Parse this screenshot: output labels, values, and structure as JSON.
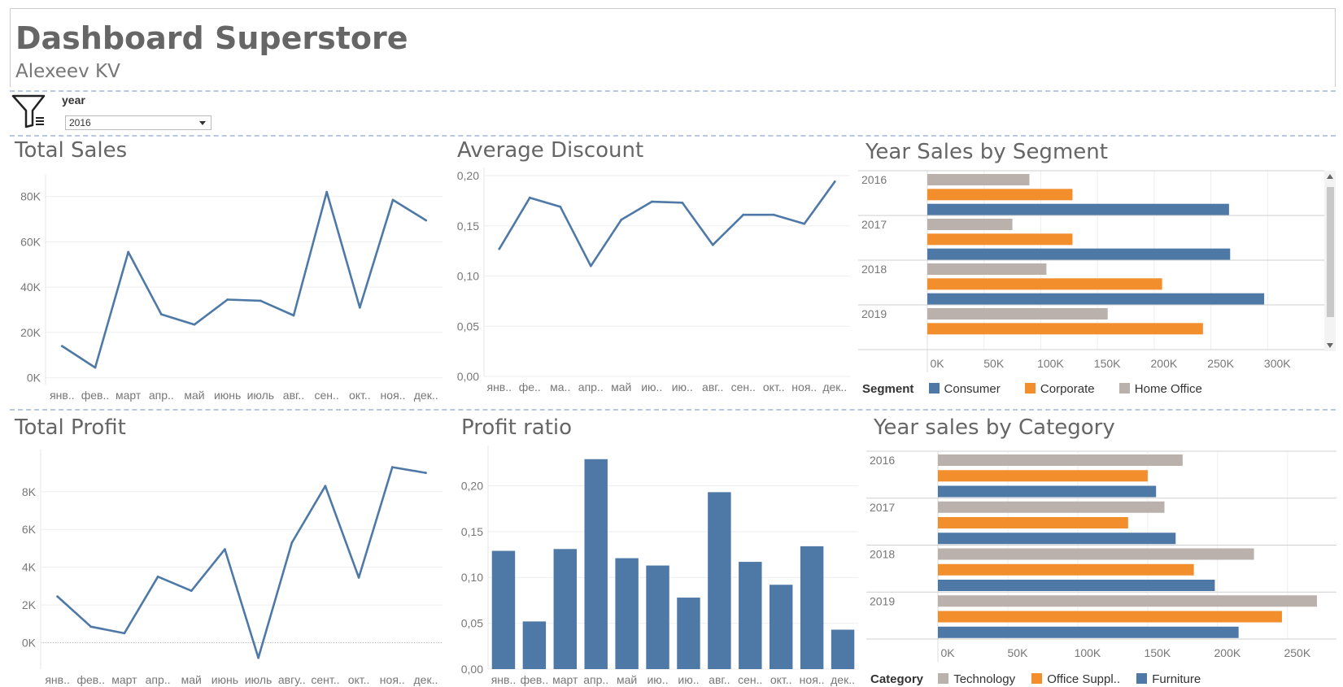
{
  "header": {
    "title": "Dashboard Superstore",
    "subtitle": "Alexeev KV"
  },
  "filter": {
    "label": "year",
    "value": "2016",
    "icon": "filter-icon"
  },
  "colors": {
    "consumer": "#4e79a7",
    "corporate": "#f28e2b",
    "home_office": "#bab0ac",
    "line": "#4e79a7"
  },
  "chart_data": [
    {
      "id": "total_sales",
      "type": "line",
      "title": "Total Sales",
      "categories": [
        "янв..",
        "фев..",
        "март",
        "апр..",
        "май",
        "июнь",
        "июль",
        "авг..",
        "сен..",
        "окт..",
        "ноя..",
        "дек.."
      ],
      "values": [
        14000,
        4500,
        55500,
        28000,
        23500,
        34500,
        34000,
        27500,
        82000,
        31000,
        78500,
        69500
      ],
      "yticks": [
        0,
        20000,
        40000,
        60000,
        80000
      ],
      "ytick_labels": [
        "0K",
        "20K",
        "40K",
        "60K",
        "80K"
      ],
      "ylim": [
        -3000,
        86000
      ]
    },
    {
      "id": "avg_discount",
      "type": "line",
      "title": "Average Discount",
      "categories": [
        "янв..",
        "фе..",
        "ма..",
        "апр..",
        "май",
        "ию..",
        "ию..",
        "авг..",
        "сен..",
        "окт..",
        "ноя..",
        "дек.."
      ],
      "values": [
        0.127,
        0.178,
        0.169,
        0.11,
        0.156,
        0.174,
        0.173,
        0.131,
        0.161,
        0.161,
        0.152,
        0.194
      ],
      "yticks": [
        0,
        0.05,
        0.1,
        0.15,
        0.2
      ],
      "ytick_labels": [
        "0,00",
        "0,05",
        "0,10",
        "0,15",
        "0,20"
      ],
      "ylim": [
        0,
        0.2
      ]
    },
    {
      "id": "total_profit",
      "type": "line",
      "title": "Total Profit",
      "categories": [
        "янв..",
        "фев..",
        "март",
        "апр..",
        "май",
        "июнь",
        "июль",
        "авгу..",
        "сент..",
        "окт..",
        "ноя..",
        "дек.."
      ],
      "values": [
        2450,
        850,
        500,
        3500,
        2750,
        4950,
        -800,
        5300,
        8300,
        3450,
        9300,
        9000
      ],
      "yticks": [
        0,
        2000,
        4000,
        6000,
        8000
      ],
      "ytick_labels": [
        "0K",
        "2K",
        "4K",
        "6K",
        "8K"
      ],
      "ylim": [
        -1400,
        9800
      ]
    },
    {
      "id": "profit_ratio",
      "type": "bar",
      "title": "Profit ratio",
      "categories": [
        "янв..",
        "фев..",
        "март",
        "апр..",
        "май",
        "ию..",
        "ию..",
        "авг..",
        "сен..",
        "окт..",
        "ноя..",
        "дек.."
      ],
      "values": [
        0.129,
        0.052,
        0.131,
        0.229,
        0.121,
        0.113,
        0.078,
        0.193,
        0.117,
        0.092,
        0.134,
        0.043
      ],
      "yticks": [
        0,
        0.05,
        0.1,
        0.15,
        0.2
      ],
      "ytick_labels": [
        "0,00",
        "0,05",
        "0,10",
        "0,15",
        "0,20"
      ],
      "ylim": [
        0,
        0.235
      ]
    },
    {
      "id": "sales_by_segment",
      "type": "bar",
      "orientation": "horizontal",
      "title": "Year Sales by Segment",
      "categories": [
        "2016",
        "2017",
        "2018",
        "2019"
      ],
      "series": [
        {
          "name": "Home Office",
          "values": [
            90000,
            75000,
            105000,
            159000
          ]
        },
        {
          "name": "Corporate",
          "values": [
            128000,
            128000,
            207000,
            243000
          ]
        },
        {
          "name": "Consumer",
          "values": [
            266000,
            267000,
            297000,
            null
          ]
        }
      ],
      "xticks": [
        0,
        50000,
        100000,
        150000,
        200000,
        250000,
        300000
      ],
      "xtick_labels": [
        "0K",
        "50K",
        "100K",
        "150K",
        "200K",
        "250K",
        "300K"
      ],
      "xlim": [
        0,
        350000
      ],
      "legend": {
        "title": "Segment",
        "items": [
          "Consumer",
          "Corporate",
          "Home Office"
        ]
      }
    },
    {
      "id": "sales_by_category",
      "type": "bar",
      "orientation": "horizontal",
      "title": "Year sales by Category",
      "categories": [
        "2016",
        "2017",
        "2018",
        "2019"
      ],
      "series": [
        {
          "name": "Technology",
          "values": [
            175000,
            162000,
            226000,
            271000
          ]
        },
        {
          "name": "Office Suppl..",
          "values": [
            150000,
            136000,
            183000,
            246000
          ]
        },
        {
          "name": "Furniture",
          "values": [
            156000,
            170000,
            198000,
            215000
          ]
        }
      ],
      "xticks": [
        0,
        50000,
        100000,
        150000,
        200000,
        250000
      ],
      "xtick_labels": [
        "0K",
        "50K",
        "100K",
        "150K",
        "200K",
        "250K"
      ],
      "xlim": [
        0,
        285000
      ],
      "legend": {
        "title": "Category",
        "items": [
          "Technology",
          "Office Suppl..",
          "Furniture"
        ]
      }
    }
  ]
}
